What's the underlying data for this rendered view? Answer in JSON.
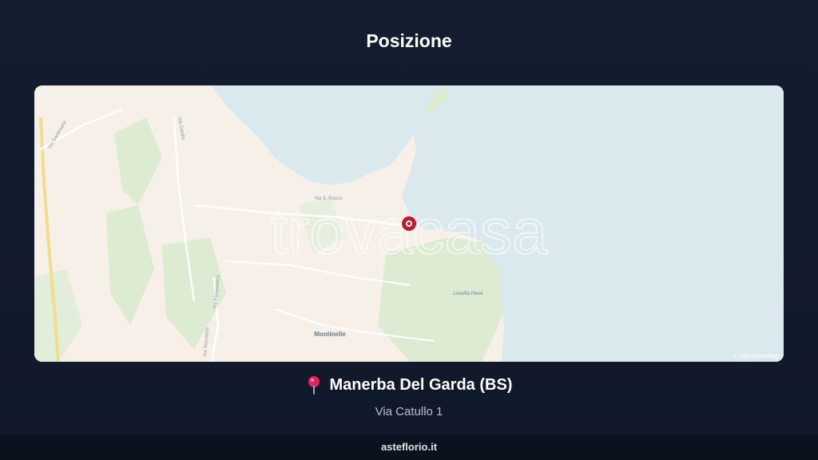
{
  "page": {
    "title": "Posizione"
  },
  "map": {
    "watermark": "trovacasa",
    "attribution": "© OpenStreetMap",
    "labels": {
      "montinelle": "Montinelle",
      "via_catullo": "Via Catullo",
      "via_gardesana": "Via Gardesana",
      "via_panoramica": "Via Panoramica",
      "via_toscolano": "Via Toscolano",
      "loc_pieve": "Località Pieve",
      "via_s_rocco": "Via S. Rocco"
    },
    "marker_icon": "map-pin-marker",
    "colors": {
      "water": "#d9e9ee",
      "land": "#f6f0e8",
      "green": "#dcebd2",
      "marker": "#c0192c"
    }
  },
  "location": {
    "pin_icon": "round-pushpin-icon",
    "city": "Manerba Del Garda (BS)",
    "address": "Via Catullo 1"
  },
  "footer": {
    "brand": "asteflorio.it"
  }
}
